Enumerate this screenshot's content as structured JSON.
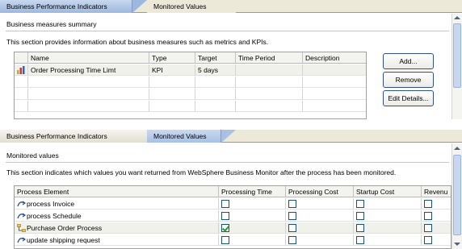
{
  "top_editor": {
    "tabs": [
      {
        "label": "Business Performance Indicators",
        "active": true
      },
      {
        "label": "Monitored Values",
        "active": false
      }
    ],
    "section": {
      "title": "Business measures summary",
      "description": "This section provides information about business measures such as metrics and KPIs."
    },
    "table": {
      "columns": [
        "",
        "Name",
        "Type",
        "Target",
        "Time Period",
        "Description"
      ],
      "rows": [
        {
          "icon": "kpi-bar-chart-icon",
          "name": "Order Processing Time Limt",
          "type": "KPI",
          "target": "5 days",
          "time_period": "",
          "description": ""
        }
      ]
    },
    "buttons": {
      "add": "Add...",
      "remove": "Remove",
      "edit": "Edit Details..."
    }
  },
  "bottom_editor": {
    "tabs": [
      {
        "label": "Business Performance Indicators",
        "active": false
      },
      {
        "label": "Monitored Values",
        "active": true
      }
    ],
    "section": {
      "title": "Monitored values",
      "description": "This section indicates which values you want returned from WebSphere Business Monitor after the process has been monitored."
    },
    "table": {
      "columns": [
        "Process Element",
        "Processing Time",
        "Processing Cost",
        "Startup Cost",
        "Revenu"
      ],
      "rows": [
        {
          "icon": "process-task-icon",
          "label": "process Invoice",
          "checks": [
            false,
            false,
            false,
            false
          ]
        },
        {
          "icon": "process-task-icon",
          "label": "process Schedule",
          "checks": [
            false,
            false,
            false,
            false
          ]
        },
        {
          "icon": "process-flow-icon",
          "label": "Purchase Order Process",
          "checks": [
            true,
            false,
            false,
            false
          ]
        },
        {
          "icon": "process-task-icon",
          "label": "update shipping request",
          "checks": [
            false,
            false,
            false,
            false
          ]
        }
      ]
    }
  },
  "colors": {
    "active_tab": "#9db8df",
    "tab_bar": "#ece9d8",
    "button_border": "#30508a",
    "checkmark": "#21a121"
  }
}
